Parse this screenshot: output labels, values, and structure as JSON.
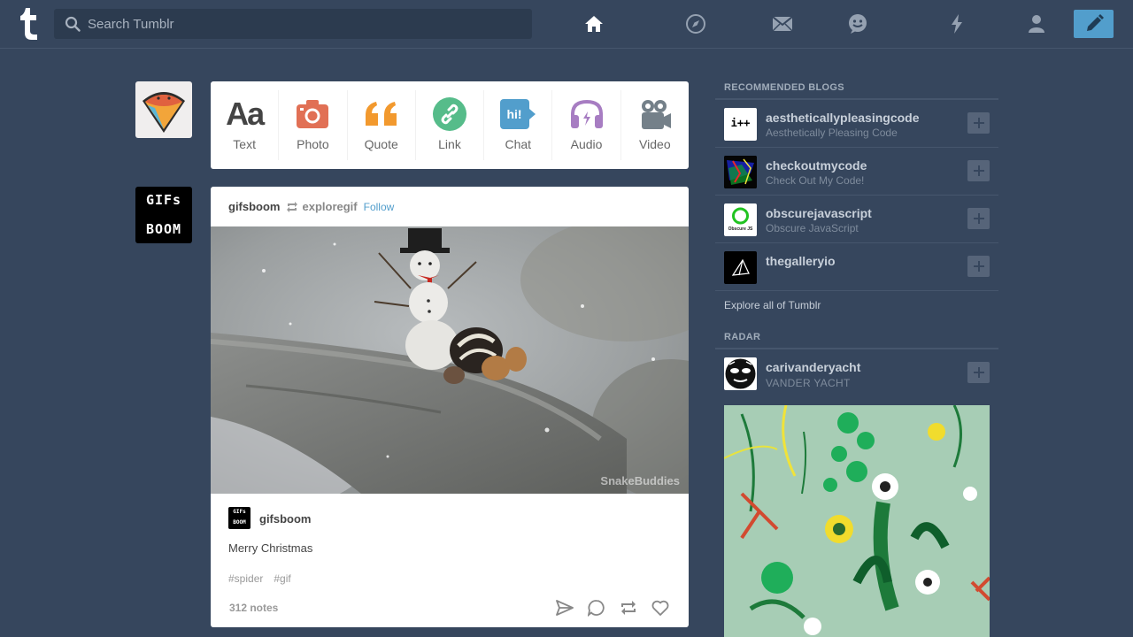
{
  "header": {
    "search_placeholder": "Search Tumblr",
    "nav_icons": [
      "home-icon",
      "explore-icon",
      "inbox-icon",
      "messaging-icon",
      "activity-icon",
      "account-icon"
    ],
    "compose_icon": "pencil-icon",
    "accent": "#529ecc",
    "bg": "#36465d"
  },
  "post_types": [
    {
      "label": "Text",
      "color": "#444444"
    },
    {
      "label": "Photo",
      "color": "#e17055"
    },
    {
      "label": "Quote",
      "color": "#f2992e"
    },
    {
      "label": "Link",
      "color": "#56bc8a"
    },
    {
      "label": "Chat",
      "color": "#529ecc"
    },
    {
      "label": "Audio",
      "color": "#a77dc2"
    },
    {
      "label": "Video",
      "color": "#748089"
    }
  ],
  "avatars": {
    "gif_avatar_text": [
      "GIFs",
      "BOOM"
    ]
  },
  "post": {
    "blog": "gifsboom",
    "reblogged_from": "exploregif",
    "follow_label": "Follow",
    "watermark": "SnakeBuddies",
    "footer_blog": "gifsboom",
    "footer_avatar_text": [
      "GIFs",
      "BOOM"
    ],
    "caption": "Merry Christmas",
    "tags": [
      "#spider",
      "#gif"
    ],
    "notes": "312 notes",
    "actions": [
      "share-icon",
      "reply-icon",
      "reblog-icon",
      "like-icon"
    ]
  },
  "sidebar": {
    "recommended_title": "RECOMMENDED BLOGS",
    "recommended": [
      {
        "name": "aestheticallypleasingcode",
        "title": "Aesthetically Pleasing Code",
        "avatar_text": "i++"
      },
      {
        "name": "checkoutmycode",
        "title": "Check Out My Code!"
      },
      {
        "name": "obscurejavascript",
        "title": "Obscure JavaScript",
        "avatar_text": "Obscure JS"
      },
      {
        "name": "thegalleryio",
        "title": ""
      }
    ],
    "explore_label": "Explore all of Tumblr",
    "radar_title": "RADAR",
    "radar": {
      "name": "carivanderyacht",
      "title": "VANDER YACHT"
    }
  }
}
